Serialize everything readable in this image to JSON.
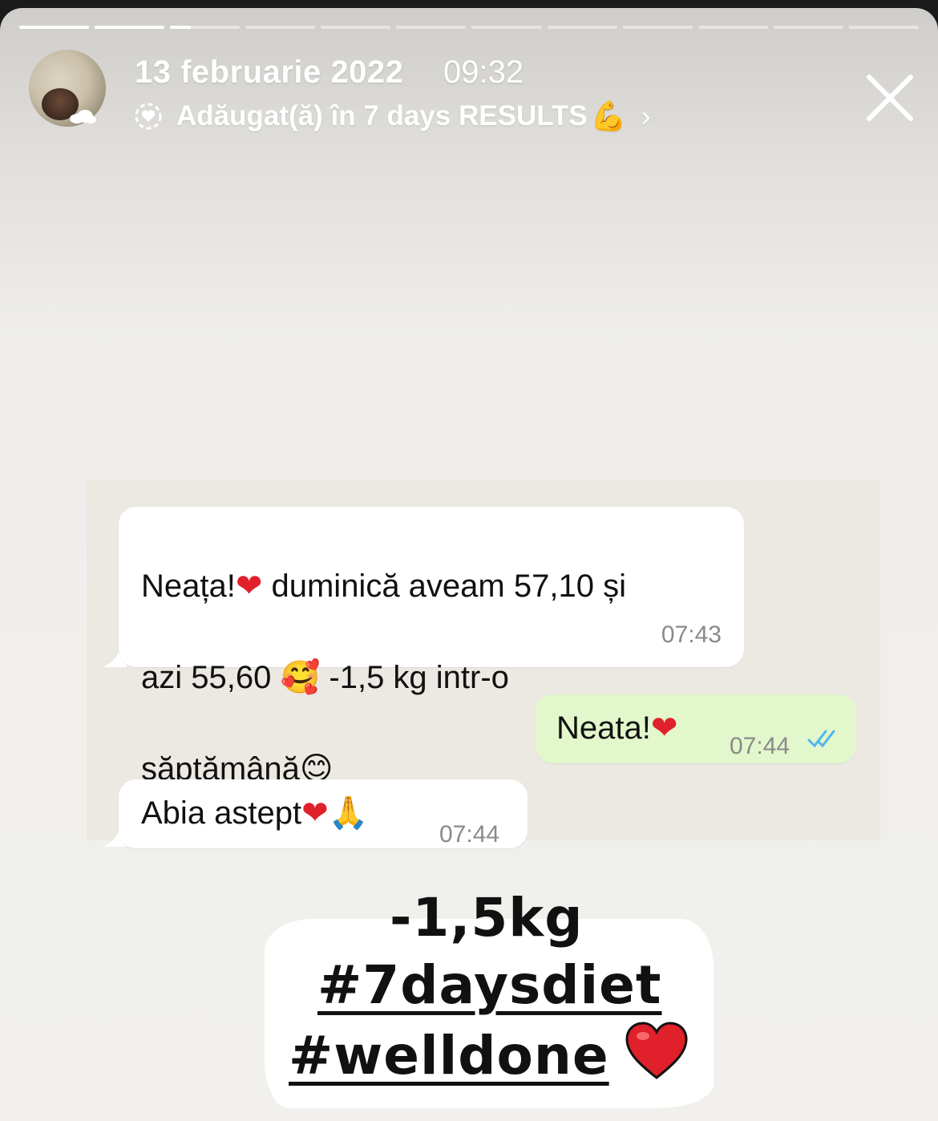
{
  "story": {
    "progress_segments": [
      1,
      1,
      0.3,
      0,
      0,
      0,
      0,
      0,
      0,
      0,
      0,
      0
    ],
    "date": "13 februarie 2022",
    "time": "09:32",
    "added_prefix": "Adăugat(ă) în 7 days RESULTS",
    "added_emoji": "💪",
    "chevron": "›",
    "highlight_icon": "highlight-heart-icon",
    "close_icon": "close-icon"
  },
  "chat": {
    "messages": [
      {
        "direction": "incoming",
        "text_line1": "Neața!",
        "text_line1b": " duminică aveam 57,10 și",
        "text_line2a": "azi 55,60 ",
        "text_line2b": " -1,5 kg intr-o",
        "text_line3": "săptămână",
        "emoji_heart": "❤",
        "emoji_love": "🥰",
        "emoji_smile": "😊",
        "time": "07:43"
      },
      {
        "direction": "outgoing",
        "text": "Neata!",
        "emoji_heart": "❤",
        "time": "07:44",
        "status_icon": "double-check-icon"
      },
      {
        "direction": "incoming",
        "text": "Abia astept",
        "emoji_heart": "❤",
        "emoji_pray": "🙏",
        "time": "07:44"
      }
    ],
    "colors": {
      "incoming_bubble": "#ffffff",
      "outgoing_bubble": "#e2f7cb",
      "read_ticks": "#4fb6ec"
    }
  },
  "sticker": {
    "line1": "-1,5kg",
    "line2": "#7daysdiet",
    "line3": "#welldone",
    "heart_icon": "heart-icon"
  }
}
